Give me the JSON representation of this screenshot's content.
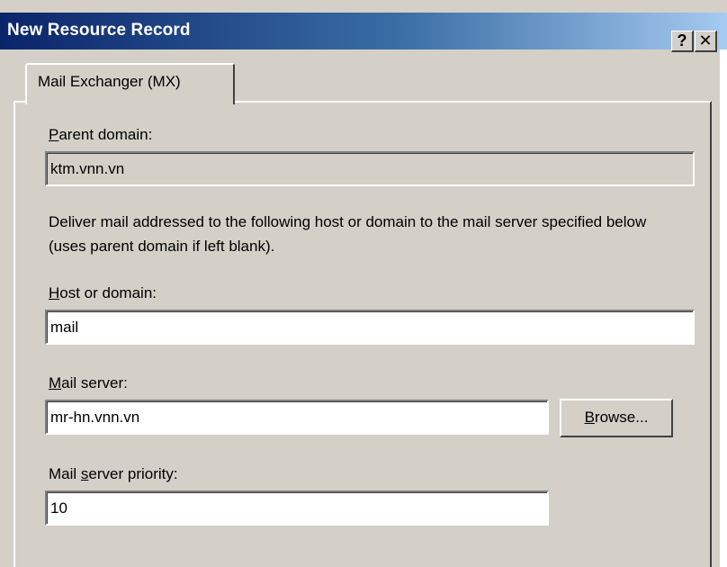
{
  "window": {
    "title": "New Resource Record",
    "help_glyph": "?",
    "close_glyph": "✕"
  },
  "tab": {
    "label": "Mail Exchanger (MX)"
  },
  "parent_domain": {
    "label_mnemonic": "P",
    "label_rest": "arent domain:",
    "value": "ktm.vnn.vn"
  },
  "description": "Deliver mail addressed to the following host or domain to the mail server specified below (uses parent domain if left blank).",
  "host_or_domain": {
    "label_mnemonic": "H",
    "label_rest": "ost or domain:",
    "value": "mail"
  },
  "mail_server": {
    "label_mnemonic": "M",
    "label_rest": "ail server:",
    "value": "mr-hn.vnn.vn",
    "browse_mnemonic": "B",
    "browse_rest": "rowse..."
  },
  "mail_server_priority": {
    "label_pre": "Mail ",
    "label_mnemonic": "s",
    "label_rest": "erver priority:",
    "value": "10"
  }
}
